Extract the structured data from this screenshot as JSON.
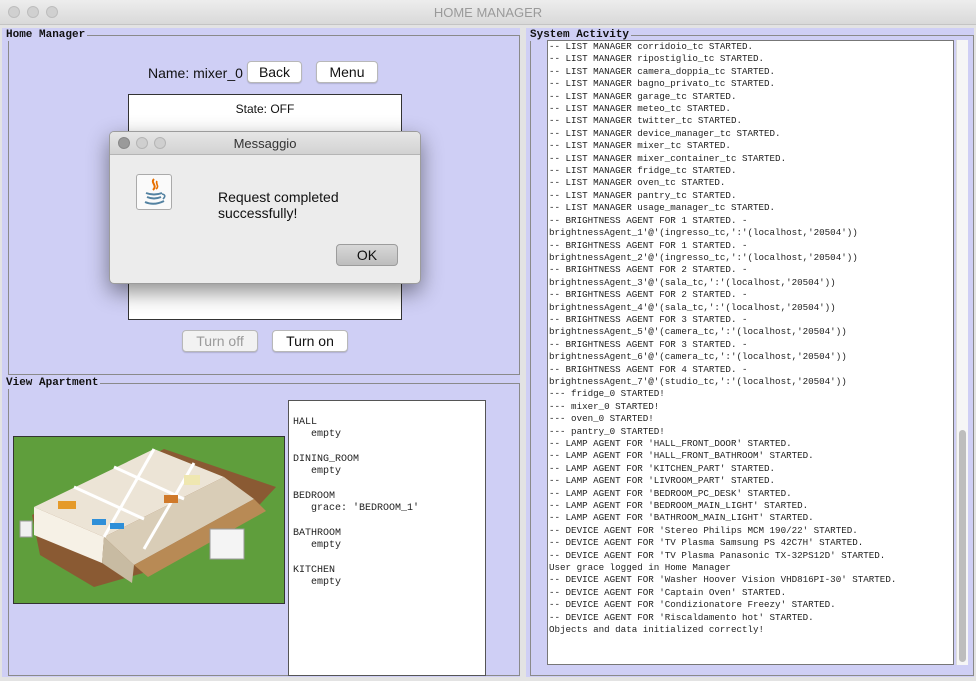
{
  "window": {
    "title": "HOME MANAGER"
  },
  "home_manager": {
    "panel_title": "Home Manager",
    "name_label": "Name: mixer_0",
    "back_button": "Back",
    "menu_button": "Menu",
    "state_text": "State: OFF",
    "turn_off_button": "Turn off",
    "turn_on_button": "Turn on"
  },
  "dialog": {
    "title": "Messaggio",
    "message": "Request completed successfully!",
    "ok_button": "OK",
    "icon": "java-cup-icon"
  },
  "view_apartment": {
    "panel_title": "View Apartment",
    "image": "apartment-3d-render",
    "rooms_text": "HALL\n   empty\n\nDINING_ROOM\n   empty\n\nBEDROOM\n   grace: 'BEDROOM_1'\n\nBATHROOM\n   empty\n\nKITCHEN\n   empty"
  },
  "system_activity": {
    "panel_title": "System Activity",
    "log_text": "-- LIST MANAGER corridoio_tc STARTED.\n-- LIST MANAGER ripostiglio_tc STARTED.\n-- LIST MANAGER camera_doppia_tc STARTED.\n-- LIST MANAGER bagno_privato_tc STARTED.\n-- LIST MANAGER garage_tc STARTED.\n-- LIST MANAGER meteo_tc STARTED.\n-- LIST MANAGER twitter_tc STARTED.\n-- LIST MANAGER device_manager_tc STARTED.\n-- LIST MANAGER mixer_tc STARTED.\n-- LIST MANAGER mixer_container_tc STARTED.\n-- LIST MANAGER fridge_tc STARTED.\n-- LIST MANAGER oven_tc STARTED.\n-- LIST MANAGER pantry_tc STARTED.\n-- LIST MANAGER usage_manager_tc STARTED.\n-- BRIGHTNESS AGENT FOR 1 STARTED. -\nbrightnessAgent_1'@'(ingresso_tc,':'(localhost,'20504'))\n-- BRIGHTNESS AGENT FOR 1 STARTED. -\nbrightnessAgent_2'@'(ingresso_tc,':'(localhost,'20504'))\n-- BRIGHTNESS AGENT FOR 2 STARTED. -\nbrightnessAgent_3'@'(sala_tc,':'(localhost,'20504'))\n-- BRIGHTNESS AGENT FOR 2 STARTED. -\nbrightnessAgent_4'@'(sala_tc,':'(localhost,'20504'))\n-- BRIGHTNESS AGENT FOR 3 STARTED. -\nbrightnessAgent_5'@'(camera_tc,':'(localhost,'20504'))\n-- BRIGHTNESS AGENT FOR 3 STARTED. -\nbrightnessAgent_6'@'(camera_tc,':'(localhost,'20504'))\n-- BRIGHTNESS AGENT FOR 4 STARTED. -\nbrightnessAgent_7'@'(studio_tc,':'(localhost,'20504'))\n--- fridge_0 STARTED!\n--- mixer_0 STARTED!\n--- oven_0 STARTED!\n--- pantry_0 STARTED!\n-- LAMP AGENT FOR 'HALL_FRONT_DOOR' STARTED.\n-- LAMP AGENT FOR 'HALL_FRONT_BATHROOM' STARTED.\n-- LAMP AGENT FOR 'KITCHEN_PART' STARTED.\n-- LAMP AGENT FOR 'LIVROOM_PART' STARTED.\n-- LAMP AGENT FOR 'BEDROOM_PC_DESK' STARTED.\n-- LAMP AGENT FOR 'BEDROOM_MAIN_LIGHT' STARTED.\n-- LAMP AGENT FOR 'BATHROOM_MAIN_LIGHT' STARTED.\n-- DEVICE AGENT FOR 'Stereo Philips MCM 190/22' STARTED.\n-- DEVICE AGENT FOR 'TV Plasma Samsung PS 42C7H' STARTED.\n-- DEVICE AGENT FOR 'TV Plasma Panasonic TX-32PS12D' STARTED.\nUser grace logged in Home Manager\n-- DEVICE AGENT FOR 'Washer Hoover Vision VHD816PI-30' STARTED.\n-- DEVICE AGENT FOR 'Captain Oven' STARTED.\n-- DEVICE AGENT FOR 'Condizionatore Freezy' STARTED.\n-- DEVICE AGENT FOR 'Riscaldamento hot' STARTED.\nObjects and data initialized correctly!"
  },
  "colors": {
    "panel_background": "#cfcff5",
    "window_background": "#e3e3e3"
  }
}
